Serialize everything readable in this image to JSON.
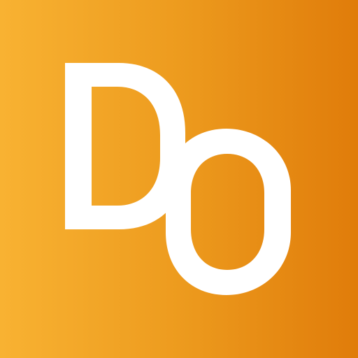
{
  "app_icon": {
    "name": "Do",
    "icon_semantic": "do-logo-icon",
    "logo_text": "Do",
    "colors": {
      "gradient_start": "#f8b232",
      "gradient_mid": "#ed9b1e",
      "gradient_end": "#e07c0a",
      "glyph": "#ffffff"
    }
  }
}
